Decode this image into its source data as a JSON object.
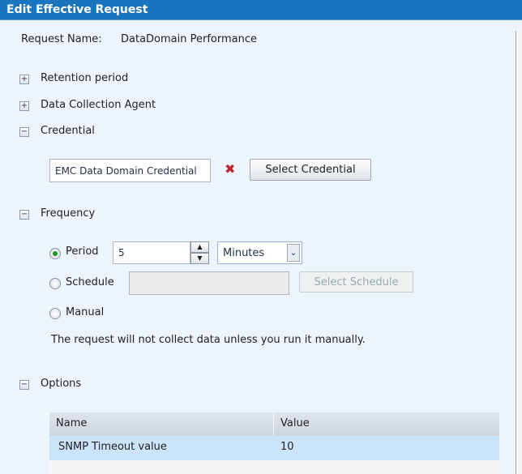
{
  "title": "Edit Effective Request",
  "request": {
    "label": "Request Name:",
    "value": "DataDomain Performance"
  },
  "sections": {
    "retention": {
      "label": "Retention period",
      "expanded": false
    },
    "agent": {
      "label": "Data Collection Agent",
      "expanded": false
    },
    "credential": {
      "label": "Credential",
      "expanded": true
    },
    "frequency": {
      "label": "Frequency",
      "expanded": true
    },
    "options": {
      "label": "Options",
      "expanded": true
    }
  },
  "credential": {
    "value": "EMC Data Domain Credential",
    "clear_icon": "red-x-icon",
    "select_label": "Select Credential"
  },
  "frequency": {
    "period_label": "Period",
    "period_value": "5",
    "unit": "Minutes",
    "schedule_label": "Schedule",
    "schedule_value": "",
    "select_schedule_label": "Select Schedule",
    "manual_label": "Manual",
    "selected": "Period",
    "note": "The request will not collect data unless you run it manually."
  },
  "options": {
    "columns": [
      "Name",
      "Value"
    ],
    "rows": [
      {
        "name": "SNMP Timeout value",
        "value": "10"
      }
    ]
  },
  "colors": {
    "titlebar": "#1a75bf",
    "background": "#eef4fd",
    "selected_row": "#cce4fb"
  }
}
